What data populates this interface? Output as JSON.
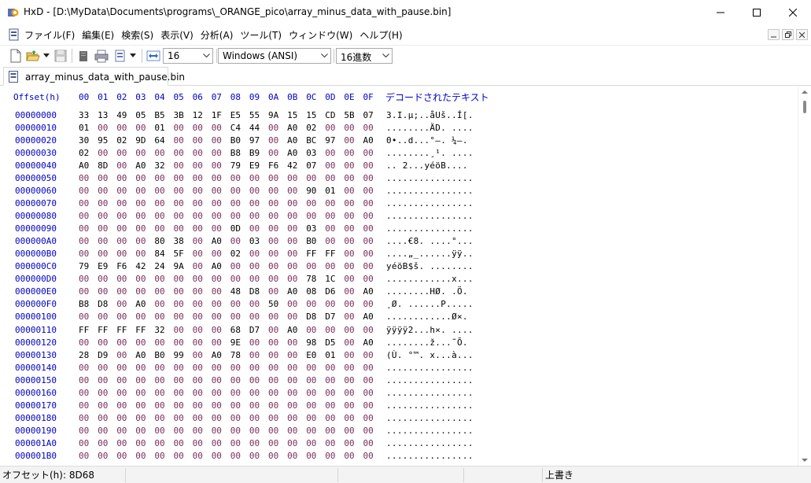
{
  "window": {
    "title": "HxD - [D:\\MyData\\Documents\\programs\\_ORANGE_pico\\array_minus_data_with_pause.bin]"
  },
  "menu": {
    "items": [
      "ファイル(F)",
      "編集(E)",
      "検索(S)",
      "表示(V)",
      "分析(A)",
      "ツール(T)",
      "ウィンドウ(W)",
      "ヘルプ(H)"
    ]
  },
  "toolbar": {
    "bytes_per_row": "16",
    "charset": "Windows (ANSI)",
    "offset_base": "16進数"
  },
  "tab": {
    "label": "array_minus_data_with_pause.bin"
  },
  "editor": {
    "offset_header": "Offset(h)",
    "column_headers": [
      "00",
      "01",
      "02",
      "03",
      "04",
      "05",
      "06",
      "07",
      "08",
      "09",
      "0A",
      "0B",
      "0C",
      "0D",
      "0E",
      "0F"
    ],
    "decoded_header": "デコードされたテキスト",
    "rows": [
      {
        "offset": "00000000",
        "bytes": [
          "33",
          "13",
          "49",
          "05",
          "B5",
          "3B",
          "12",
          "1F",
          "E5",
          "55",
          "9A",
          "15",
          "15",
          "CD",
          "5B",
          "07"
        ],
        "ascii": "3.I.µ;..åUš..Í[."
      },
      {
        "offset": "00000010",
        "bytes": [
          "01",
          "00",
          "00",
          "00",
          "01",
          "00",
          "00",
          "00",
          "C4",
          "44",
          "00",
          "A0",
          "02",
          "00",
          "00",
          "00"
        ],
        "ascii": "........ÄD. ...."
      },
      {
        "offset": "00000020",
        "bytes": [
          "30",
          "95",
          "02",
          "9D",
          "64",
          "00",
          "00",
          "00",
          "B0",
          "97",
          "00",
          "A0",
          "BC",
          "97",
          "00",
          "A0"
        ],
        "ascii": "0•..d...°—. ¼—. "
      },
      {
        "offset": "00000030",
        "bytes": [
          "02",
          "00",
          "00",
          "00",
          "00",
          "00",
          "00",
          "00",
          "B8",
          "B9",
          "00",
          "A0",
          "03",
          "00",
          "00",
          "00"
        ],
        "ascii": "........¸¹. ...."
      },
      {
        "offset": "00000040",
        "bytes": [
          "A0",
          "8D",
          "00",
          "A0",
          "32",
          "00",
          "00",
          "00",
          "79",
          "E9",
          "F6",
          "42",
          "07",
          "00",
          "00",
          "00"
        ],
        "ascii": " .. 2...yéöB...."
      },
      {
        "offset": "00000050",
        "bytes": [
          "00",
          "00",
          "00",
          "00",
          "00",
          "00",
          "00",
          "00",
          "00",
          "00",
          "00",
          "00",
          "00",
          "00",
          "00",
          "00"
        ],
        "ascii": "................"
      },
      {
        "offset": "00000060",
        "bytes": [
          "00",
          "00",
          "00",
          "00",
          "00",
          "00",
          "00",
          "00",
          "00",
          "00",
          "00",
          "00",
          "90",
          "01",
          "00",
          "00"
        ],
        "ascii": "................"
      },
      {
        "offset": "00000070",
        "bytes": [
          "00",
          "00",
          "00",
          "00",
          "00",
          "00",
          "00",
          "00",
          "00",
          "00",
          "00",
          "00",
          "00",
          "00",
          "00",
          "00"
        ],
        "ascii": "................"
      },
      {
        "offset": "00000080",
        "bytes": [
          "00",
          "00",
          "00",
          "00",
          "00",
          "00",
          "00",
          "00",
          "00",
          "00",
          "00",
          "00",
          "00",
          "00",
          "00",
          "00"
        ],
        "ascii": "................"
      },
      {
        "offset": "00000090",
        "bytes": [
          "00",
          "00",
          "00",
          "00",
          "00",
          "00",
          "00",
          "00",
          "0D",
          "00",
          "00",
          "00",
          "03",
          "00",
          "00",
          "00"
        ],
        "ascii": "................"
      },
      {
        "offset": "000000A0",
        "bytes": [
          "00",
          "00",
          "00",
          "00",
          "80",
          "38",
          "00",
          "A0",
          "00",
          "03",
          "00",
          "00",
          "B0",
          "00",
          "00",
          "00"
        ],
        "ascii": "....€8. ....°..."
      },
      {
        "offset": "000000B0",
        "bytes": [
          "00",
          "00",
          "00",
          "00",
          "84",
          "5F",
          "00",
          "00",
          "02",
          "00",
          "00",
          "00",
          "FF",
          "FF",
          "00",
          "00"
        ],
        "ascii": "....„_......ÿÿ.."
      },
      {
        "offset": "000000C0",
        "bytes": [
          "79",
          "E9",
          "F6",
          "42",
          "24",
          "9A",
          "00",
          "A0",
          "00",
          "00",
          "00",
          "00",
          "00",
          "00",
          "00",
          "00"
        ],
        "ascii": "yéöB$š. ........"
      },
      {
        "offset": "000000D0",
        "bytes": [
          "00",
          "00",
          "00",
          "00",
          "00",
          "00",
          "00",
          "00",
          "00",
          "00",
          "00",
          "00",
          "78",
          "1C",
          "00",
          "00"
        ],
        "ascii": "............x..."
      },
      {
        "offset": "000000E0",
        "bytes": [
          "00",
          "00",
          "00",
          "00",
          "00",
          "00",
          "00",
          "00",
          "48",
          "D8",
          "00",
          "A0",
          "08",
          "D6",
          "00",
          "A0"
        ],
        "ascii": "........HØ. .Ö. "
      },
      {
        "offset": "000000F0",
        "bytes": [
          "B8",
          "D8",
          "00",
          "A0",
          "00",
          "00",
          "00",
          "00",
          "00",
          "00",
          "50",
          "00",
          "00",
          "00",
          "00",
          "00"
        ],
        "ascii": "¸Ø. ......P....."
      },
      {
        "offset": "00000100",
        "bytes": [
          "00",
          "00",
          "00",
          "00",
          "00",
          "00",
          "00",
          "00",
          "00",
          "00",
          "00",
          "00",
          "D8",
          "D7",
          "00",
          "A0"
        ],
        "ascii": "............Ø×. "
      },
      {
        "offset": "00000110",
        "bytes": [
          "FF",
          "FF",
          "FF",
          "FF",
          "32",
          "00",
          "00",
          "00",
          "68",
          "D7",
          "00",
          "A0",
          "00",
          "00",
          "00",
          "00"
        ],
        "ascii": "ÿÿÿÿ2...h×. ...."
      },
      {
        "offset": "00000120",
        "bytes": [
          "00",
          "00",
          "00",
          "00",
          "00",
          "00",
          "00",
          "00",
          "9E",
          "00",
          "00",
          "00",
          "98",
          "D5",
          "00",
          "A0"
        ],
        "ascii": "........ž...˜Õ. "
      },
      {
        "offset": "00000130",
        "bytes": [
          "28",
          "D9",
          "00",
          "A0",
          "B0",
          "99",
          "00",
          "A0",
          "78",
          "00",
          "00",
          "00",
          "E0",
          "01",
          "00",
          "00"
        ],
        "ascii": "(Ù. °™. x...à..."
      },
      {
        "offset": "00000140",
        "bytes": [
          "00",
          "00",
          "00",
          "00",
          "00",
          "00",
          "00",
          "00",
          "00",
          "00",
          "00",
          "00",
          "00",
          "00",
          "00",
          "00"
        ],
        "ascii": "................"
      },
      {
        "offset": "00000150",
        "bytes": [
          "00",
          "00",
          "00",
          "00",
          "00",
          "00",
          "00",
          "00",
          "00",
          "00",
          "00",
          "00",
          "00",
          "00",
          "00",
          "00"
        ],
        "ascii": "................"
      },
      {
        "offset": "00000160",
        "bytes": [
          "00",
          "00",
          "00",
          "00",
          "00",
          "00",
          "00",
          "00",
          "00",
          "00",
          "00",
          "00",
          "00",
          "00",
          "00",
          "00"
        ],
        "ascii": "................"
      },
      {
        "offset": "00000170",
        "bytes": [
          "00",
          "00",
          "00",
          "00",
          "00",
          "00",
          "00",
          "00",
          "00",
          "00",
          "00",
          "00",
          "00",
          "00",
          "00",
          "00"
        ],
        "ascii": "................"
      },
      {
        "offset": "00000180",
        "bytes": [
          "00",
          "00",
          "00",
          "00",
          "00",
          "00",
          "00",
          "00",
          "00",
          "00",
          "00",
          "00",
          "00",
          "00",
          "00",
          "00"
        ],
        "ascii": "................"
      },
      {
        "offset": "00000190",
        "bytes": [
          "00",
          "00",
          "00",
          "00",
          "00",
          "00",
          "00",
          "00",
          "00",
          "00",
          "00",
          "00",
          "00",
          "00",
          "00",
          "00"
        ],
        "ascii": "................"
      },
      {
        "offset": "000001A0",
        "bytes": [
          "00",
          "00",
          "00",
          "00",
          "00",
          "00",
          "00",
          "00",
          "00",
          "00",
          "00",
          "00",
          "00",
          "00",
          "00",
          "00"
        ],
        "ascii": "................"
      },
      {
        "offset": "000001B0",
        "bytes": [
          "00",
          "00",
          "00",
          "00",
          "00",
          "00",
          "00",
          "00",
          "00",
          "00",
          "00",
          "00",
          "00",
          "00",
          "00",
          "00"
        ],
        "ascii": "................"
      }
    ]
  },
  "status": {
    "offset": "オフセット(h): 8D68",
    "mode": "上書き"
  },
  "icons": {
    "app": "hxd-app-icon",
    "new": "new-file-icon",
    "open": "open-folder-icon",
    "save": "save-disk-icon",
    "close_file": "close-file-icon",
    "print": "print-icon",
    "properties": "properties-icon",
    "width_arrows": "bytes-per-row-icon"
  },
  "colors": {
    "offset_blue": "#0000c8",
    "zero_byte": "#7a2e5a",
    "nonzero_byte": "#000000"
  }
}
